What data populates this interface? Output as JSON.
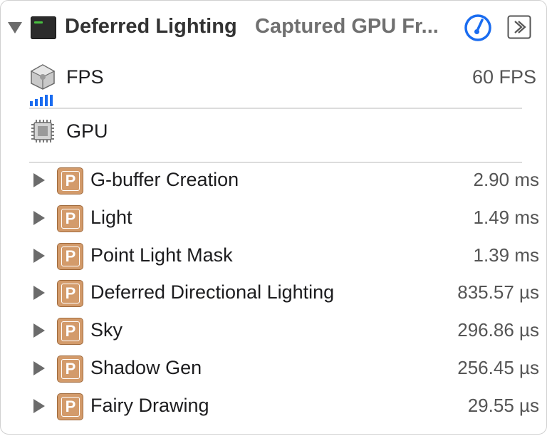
{
  "header": {
    "title": "Deferred Lighting",
    "subtitle": "Captured GPU Fr...",
    "gauge_icon": "gauge-icon",
    "jump_icon": "jump-to-icon"
  },
  "fps": {
    "label": "FPS",
    "value": "60 FPS",
    "meter_fraction": 1.0,
    "meter_color": "#1a6cf0"
  },
  "gpu": {
    "label": "GPU"
  },
  "passes": [
    {
      "label": "G-buffer Creation",
      "time": "2.90 ms"
    },
    {
      "label": "Light",
      "time": "1.49 ms"
    },
    {
      "label": "Point Light Mask",
      "time": "1.39 ms"
    },
    {
      "label": "Deferred Directional Lighting",
      "time": "835.57 µs"
    },
    {
      "label": "Sky",
      "time": "296.86 µs"
    },
    {
      "label": "Shadow Gen",
      "time": "256.45 µs"
    },
    {
      "label": "Fairy Drawing",
      "time": "29.55 µs"
    }
  ],
  "pass_badge_letter": "P",
  "colors": {
    "accent_blue": "#1a6cf0",
    "pass_badge": "#d39b6b"
  }
}
